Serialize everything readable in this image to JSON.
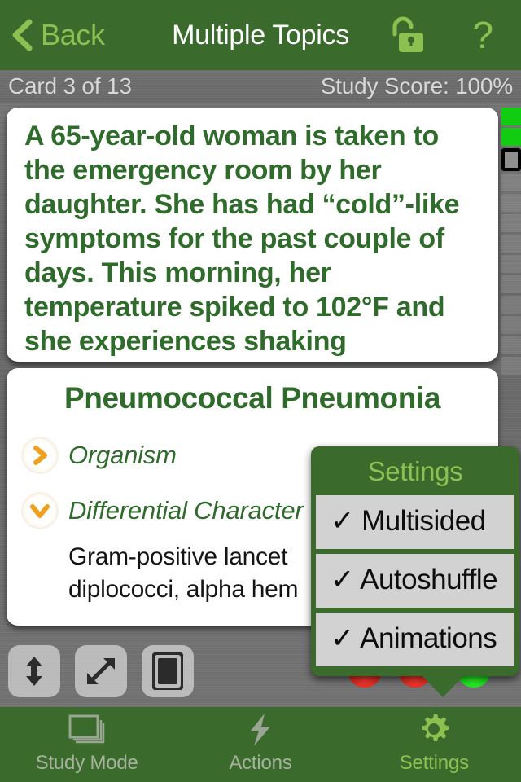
{
  "colors": {
    "brand_green": "#3a6b2d",
    "accent_green": "#8cc152",
    "card_text_green": "#2f6b2b",
    "gray_background": "#6e6e6e",
    "popup_item_gray": "#d2d2d2",
    "progress_done_green": "#11cc11",
    "disclosure_orange": "#f0a020"
  },
  "navbar": {
    "back_label": "Back",
    "back_icon": "chevron-left-icon",
    "title": "Multiple Topics",
    "lock_icon": "unlocked-padlock-icon",
    "help_icon": "question-mark-icon",
    "help_glyph": "?"
  },
  "statusbar": {
    "card_counter": "Card 3 of 13",
    "study_score": "Study Score: 100%"
  },
  "question_card": {
    "text": "A 65-year-old woman is taken to the emergency room by her daughter. She has had “cold”-like symptoms for the past couple of days. This morning, her temperature spiked to 102°F and she experiences shaking"
  },
  "answer_card": {
    "title": "Pneumococcal Pneumonia",
    "rows": [
      {
        "icon": "chevron-right-circle-icon",
        "state": "collapsed",
        "label": "Organism",
        "body": ""
      },
      {
        "icon": "chevron-down-circle-icon",
        "state": "expanded",
        "label": "Differential Character",
        "body": "Gram-positive lancet"
      }
    ],
    "body_second_line": "diplococci, alpha hem"
  },
  "progress": {
    "total": 13,
    "current_index": 3,
    "completed": 2,
    "rungs": [
      "done",
      "done",
      "current",
      "todo",
      "todo",
      "todo",
      "todo",
      "todo",
      "todo",
      "todo",
      "todo",
      "todo",
      "todo"
    ]
  },
  "toolstrip": {
    "buttons": [
      {
        "name": "resize-vertical-button",
        "icon": "double-arrow-vertical-icon"
      },
      {
        "name": "expand-fullscreen-button",
        "icon": "diagonal-arrows-expand-icon"
      },
      {
        "name": "card-fill-button",
        "icon": "filled-card-icon"
      }
    ]
  },
  "tabbar": {
    "tabs": [
      {
        "label": "Study Mode",
        "icon": "card-stack-icon",
        "active": false
      },
      {
        "label": "Actions",
        "icon": "lightning-bolt-icon",
        "active": false
      },
      {
        "label": "Settings",
        "icon": "gear-icon",
        "active": true
      }
    ]
  },
  "settings_popover": {
    "title": "Settings",
    "items": [
      {
        "label": "Multisided",
        "checked": true,
        "check_glyph": "✓"
      },
      {
        "label": "Autoshuffle",
        "checked": true,
        "check_glyph": "✓"
      },
      {
        "label": "Animations",
        "checked": true,
        "check_glyph": "✓"
      }
    ]
  }
}
